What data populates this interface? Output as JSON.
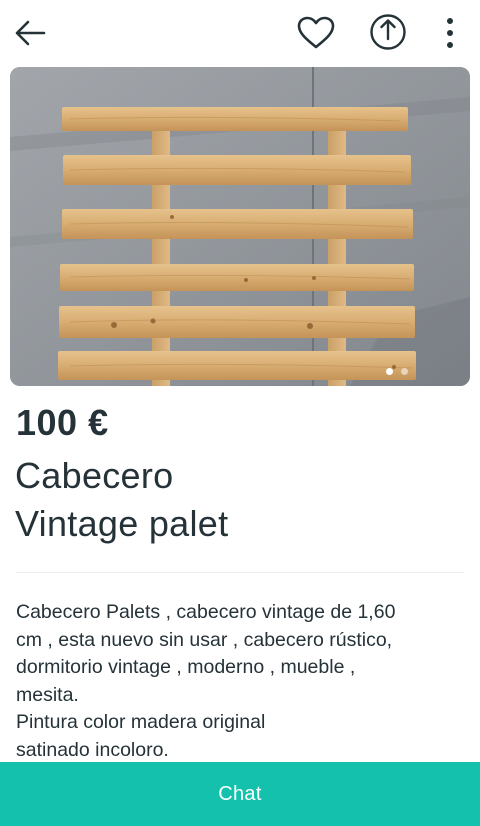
{
  "header": {
    "back_icon": "arrow-left-icon",
    "favorite_icon": "heart-outline-icon",
    "share_icon": "share-upload-icon",
    "more_icon": "more-vertical-icon"
  },
  "gallery": {
    "image_alt": "Wooden pallet headboard leaning against a grey wall",
    "page_count": 2,
    "current_page": 1
  },
  "item": {
    "price": "100 €",
    "title_line1": "Cabecero",
    "title_line2": "Vintage palet",
    "description": "Cabecero Palets , cabecero vintage de 1,60\ncm , esta nuevo sin usar , cabecero rústico,\ndormitorio vintage , moderno , mueble ,\nmesita.\nPintura color madera original\nsatinado incoloro."
  },
  "footer": {
    "chat_label": "Chat"
  },
  "colors": {
    "accent": "#13c1ac",
    "text": "#253238",
    "wood": "#d9b27a",
    "wall": "#8f949a"
  }
}
